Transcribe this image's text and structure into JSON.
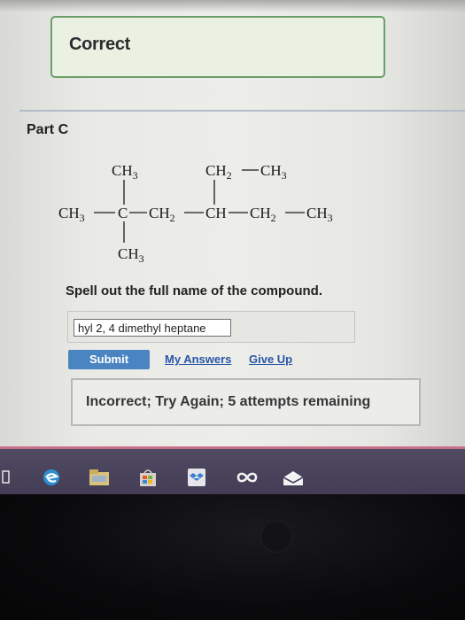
{
  "feedback_correct": "Correct",
  "part_label": "Part C",
  "structure": {
    "top_left_ch3": "CH3",
    "top_right_ch2": "CH2",
    "top_right_ch3": "CH3",
    "main_chain": [
      "CH3",
      "C",
      "CH2",
      "CH",
      "CH2",
      "CH3"
    ],
    "bottom_ch3": "CH3"
  },
  "question": "Spell out the full name of the compound.",
  "answer_input": {
    "value": "hyl 2, 4 dimethyl heptane"
  },
  "buttons": {
    "submit": "Submit",
    "my_answers": "My Answers",
    "give_up": "Give Up"
  },
  "feedback_incorrect": "Incorrect; Try Again; 5 attempts remaining",
  "taskbar_icons": [
    "task-view-icon",
    "edge-browser-icon",
    "file-explorer-icon",
    "store-icon",
    "dropbox-icon",
    "infinity-app-icon",
    "mail-icon"
  ],
  "colors": {
    "correct_border": "#6a9f6a",
    "submit_bg": "#4a85c2",
    "link": "#2a56a8",
    "taskbar": "#4a4460"
  }
}
